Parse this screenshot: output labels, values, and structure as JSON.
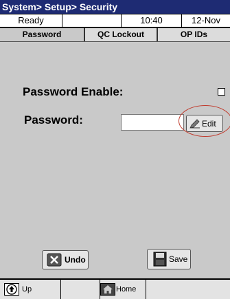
{
  "title": "System> Setup> Security",
  "status": {
    "state": "Ready",
    "blank": "",
    "time": "10:40",
    "date": "12-Nov"
  },
  "tabs": [
    {
      "label": "Password",
      "active": true
    },
    {
      "label": "QC Lockout",
      "active": false
    },
    {
      "label": "OP IDs",
      "active": false
    }
  ],
  "password_enable": {
    "label": "Password Enable:",
    "checked": false
  },
  "password": {
    "label": "Password:",
    "value": ""
  },
  "buttons": {
    "edit": "Edit",
    "undo": "Undo",
    "save": "Save"
  },
  "nav": {
    "up": "Up",
    "home": "Home"
  },
  "colors": {
    "titlebar": "#1e2b73",
    "highlight_circle": "#c0392b"
  },
  "icons": {
    "edit": "pencil-icon",
    "undo": "x-icon",
    "save": "floppy-disk-icon",
    "up": "arrow-up-icon",
    "home": "house-icon"
  }
}
